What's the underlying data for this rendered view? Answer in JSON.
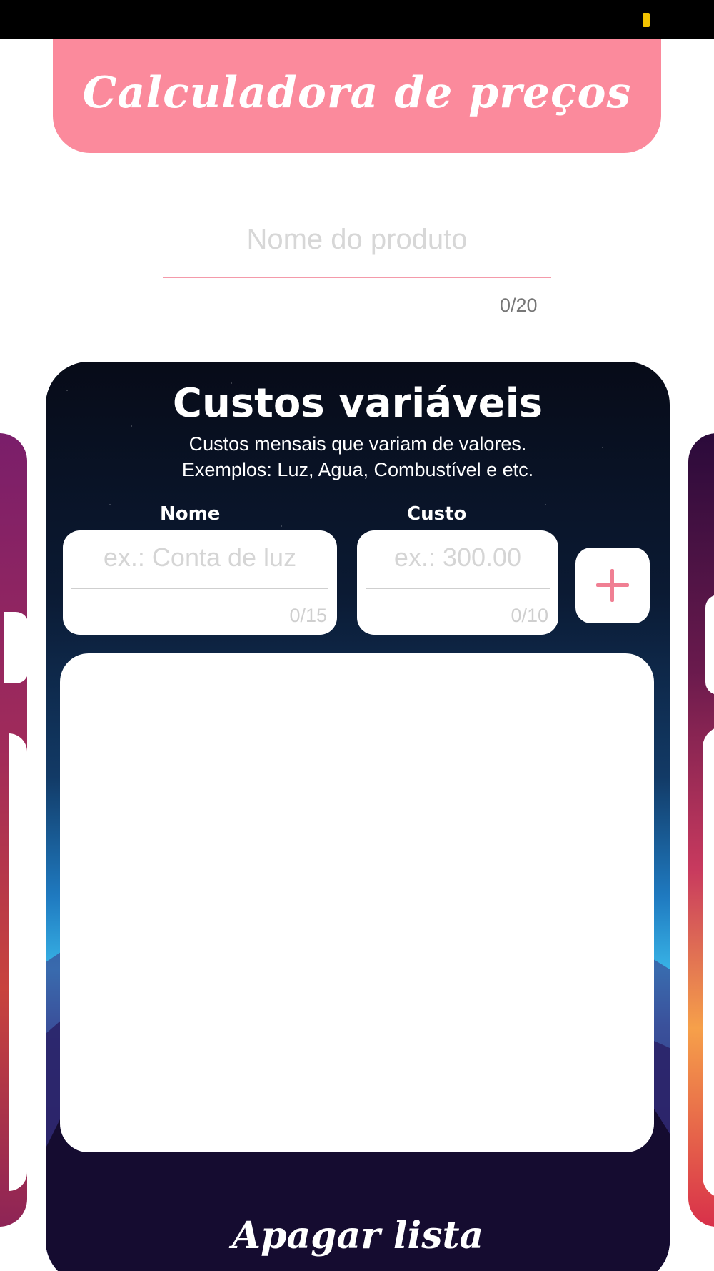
{
  "header": {
    "title": "Calculadora de preços"
  },
  "product": {
    "placeholder": "Nome do produto",
    "value": "",
    "counter": "0/20"
  },
  "card": {
    "title": "Custos variáveis",
    "description_line1": "Custos mensais que variam de valores.",
    "description_line2": "Exemplos: Luz, Agua, Combustível e etc.",
    "name_label": "Nome",
    "cost_label": "Custo",
    "name_input": {
      "placeholder": "ex.: Conta de luz",
      "value": "",
      "counter": "0/15"
    },
    "cost_input": {
      "placeholder": "ex.: 300.00",
      "value": "",
      "counter": "0/10"
    },
    "add_icon": "plus-icon",
    "list_items": [],
    "clear_button": "Apagar lista"
  },
  "colors": {
    "accent": "#fb8a9c",
    "plus": "#f07f93",
    "battery": "#f2c200"
  }
}
